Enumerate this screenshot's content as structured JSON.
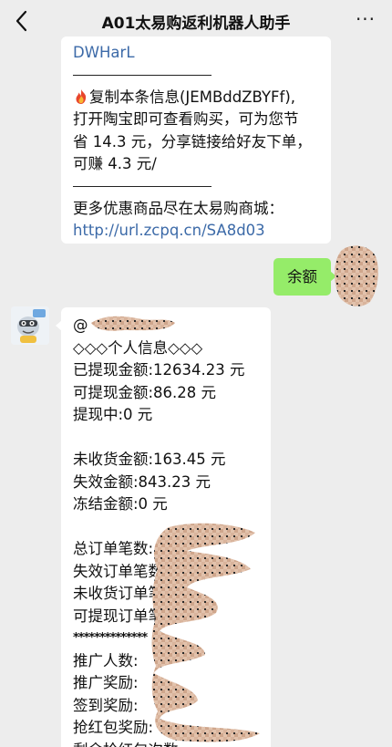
{
  "header": {
    "back_icon": "chevron-left-icon",
    "title": "A01太易购返利机器人助手",
    "more_icon": "more-dots-icon",
    "more_glyph": "···"
  },
  "messages": {
    "bot_prev": {
      "line0": "DWHarL",
      "line1_icon": "fire-emoji",
      "line1": "复制本条信息(JEMBddZBYFf),",
      "line2": "打开陶宝即可查看购买，可为您节",
      "line3": "省 14.3 元，分享链接给好友下单，",
      "line4": "可赚 4.3 元/",
      "line5": "更多优惠商品尽在太易购商城：",
      "link": "http://url.zcpq.cn/SA8d03"
    },
    "user_msg": {
      "text": "余额"
    },
    "bot_reply": {
      "mention": "@",
      "title": "◇◇◇个人信息◇◇◇",
      "withdrawn": "已提现金额:12634.23 元",
      "withdrawable": "可提现金额:86.28 元",
      "pending": "提现中:0 元",
      "unreceived": "未收货金额:163.45 元",
      "invalid": "失效金额:843.23 元",
      "frozen": "冻结金额:0 元",
      "total_orders": "总订单笔数:",
      "invalid_orders": "失效订单笔数:",
      "unreceived_orders": "未收货订单笔数:",
      "withdrawable_orders": "可提现订单笔数:",
      "stars": "**************",
      "referrals": "推广人数:",
      "referral_reward": "推广奖励:",
      "checkin_reward": "签到奖励:",
      "redpacket_reward": "抢红包奖励:",
      "redpacket_left": "剩余抢红包次数"
    }
  },
  "colors": {
    "background": "#ededed",
    "user_bubble": "#95ec69",
    "link": "#3c6aa8"
  }
}
